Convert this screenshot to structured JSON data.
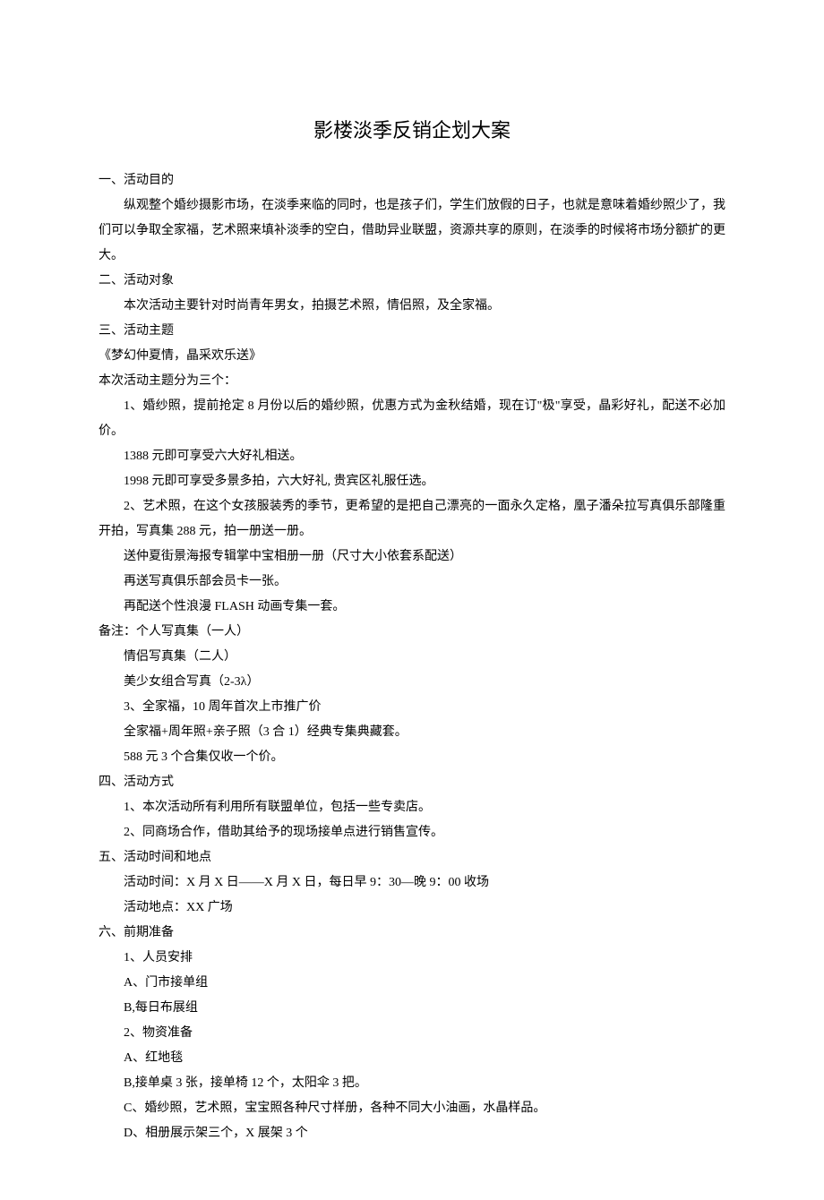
{
  "title": "影楼淡季反销企划大案",
  "sec1_h": "一、活动目的",
  "sec1_p": "纵观整个婚纱摄影市场，在淡季来临的同时，也是孩子们，学生们放假的日子，也就是意味着婚纱照少了，我们可以争取全家福，艺术照来填补淡季的空白，借助异业联盟，资源共享的原则，在淡季的时候将市场分额扩的更大。",
  "sec2_h": "二、活动对象",
  "sec2_p": "本次活动主要针对时尚青年男女，拍摄艺术照，情侣照，及全家福。",
  "sec3_h": "三、活动主题",
  "sec3_t": "《梦幻仲夏情，晶采欢乐送》",
  "sec3_sub": "本次活动主题分为三个：",
  "s3_1a": "1、婚纱照，提前抢定 8 月份以后的婚纱照，优惠方式为金秋结婚，现在订\"极\"享受，晶彩好礼，配送不必加价。",
  "s3_1b": "1388 元即可享受六大好礼相送。",
  "s3_1c": "1998 元即可享受多景多拍，六大好礼, 贵宾区礼服任选。",
  "s3_2a": "2、艺术照，在这个女孩服装秀的季节，更希望的是把自己漂亮的一面永久定格，凰子潘朵拉写真俱乐部隆重开拍，写真集 288 元，拍一册送一册。",
  "s3_2b": "送仲夏街景海报专辑掌中宝相册一册（尺寸大小依套系配送）",
  "s3_2c": "再送写真俱乐部会员卡一张。",
  "s3_2d": "再配送个性浪漫 FLASH 动画专集一套。",
  "s3_note_h": "备注：个人写真集（一人）",
  "s3_note_a": "情侣写真集（二人）",
  "s3_note_b": "美少女组合写真（2-3λ）",
  "s3_3a": "3、全家福，10 周年首次上市推广价",
  "s3_3b": "全家福+周年照+亲子照（3 合 1）经典专集典藏套。",
  "s3_3c": "588 元 3 个合集仅收一个价。",
  "sec4_h": "四、活动方式",
  "s4_1": "1、本次活动所有利用所有联盟单位，包括一些专卖店。",
  "s4_2": "2、同商场合作，借助其给予的现场接单点进行销售宣传。",
  "sec5_h": "五、活动时间和地点",
  "s5_1": "活动时间：X 月 X 日——X 月 X 日，每日早 9：30—晚 9：00 收场",
  "s5_2": "活动地点：XX 广场",
  "sec6_h": "六、前期准备",
  "s6_1": "1、人员安排",
  "s6_1a": "A、门市接单组",
  "s6_1b": "B,每日布展组",
  "s6_2": "2、物资准备",
  "s6_2a": "A、红地毯",
  "s6_2b": "B,接单桌 3 张，接单椅 12 个，太阳伞 3 把。",
  "s6_2c": "C、婚纱照，艺术照，宝宝照各种尺寸样册，各种不同大小油画，水晶样品。",
  "s6_2d": "D、相册展示架三个，X 展架 3 个"
}
